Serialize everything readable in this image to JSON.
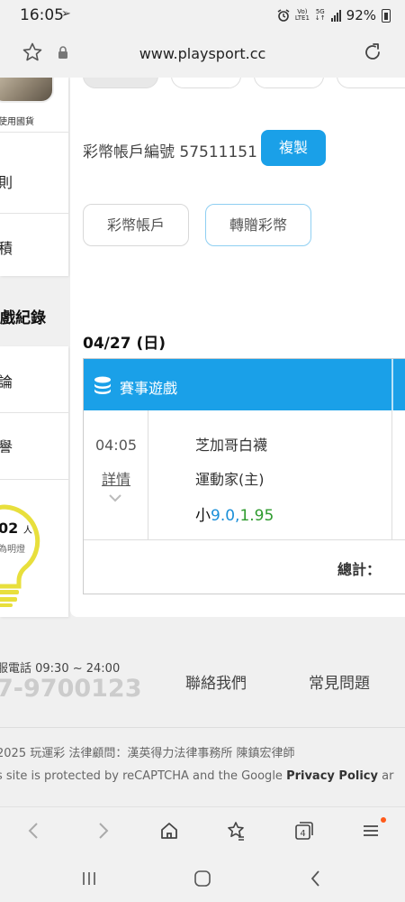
{
  "status_bar": {
    "time": "16:05",
    "volte_top": "Vo)",
    "volte_bottom": "LTE1",
    "net_top": "5G",
    "net_bottom": "↓↑",
    "battery": "92%"
  },
  "url_bar": {
    "url": "www.playsport.cc"
  },
  "sidebar": {
    "avatar_caption": "使用國貨",
    "items": [
      {
        "label": "則"
      },
      {
        "label": "積"
      }
    ],
    "heading": "戲紀錄",
    "items2": [
      {
        "label": "論"
      },
      {
        "label": "譽"
      }
    ],
    "bulb_count": "02",
    "bulb_unit": "人",
    "bulb_caption": "為明燈"
  },
  "account": {
    "label": "彩幣帳戶編號 57511151",
    "copy_label": "複製",
    "tabs": [
      {
        "label": "彩幣帳戶"
      },
      {
        "label": "轉贈彩幣"
      }
    ]
  },
  "record": {
    "date": "04/27 (日)",
    "header": "賽事遊戲",
    "game": {
      "time": "04:05",
      "detail_label": "詳情",
      "team_away": "芝加哥白襪",
      "team_home": "運動家(主)",
      "bet_side": "小",
      "bet_value": "9.0",
      "bet_sep": ",",
      "bet_odds": "1.95"
    },
    "total_label": "總計："
  },
  "footer": {
    "hotline_label": "服電話 09:30 ~ 24:00",
    "hotline_number": "7-9700123",
    "contact_label": "聯絡我們",
    "faq_label": "常見問題",
    "copyright": "2025 玩運彩 法律顧問：漢英得力法律事務所 陳鎮宏律師",
    "recaptcha_text": "s site is protected by reCAPTCHA and the Google ",
    "privacy_label": "Privacy Policy",
    "recaptcha_tail": " ar"
  },
  "colors": {
    "accent": "#1aa0e8",
    "bet_value": "#1a8fd8",
    "bet_odds": "#2e9b2e",
    "menu_badge": "#ff5a1a"
  }
}
